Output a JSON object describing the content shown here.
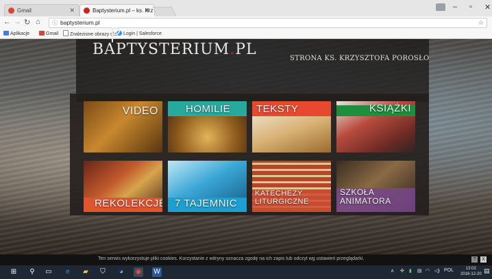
{
  "browser": {
    "tabs": [
      {
        "title": "Gmail",
        "active": false,
        "favicon_color": "#d44638"
      },
      {
        "title": "Baptysterium.pl – ks. Krz",
        "active": true,
        "favicon_color": "#d0221d"
      }
    ],
    "url": "baptysterium.pl",
    "bookmarks": [
      {
        "label": "Aplikacje",
        "icon": "apps-icon"
      },
      {
        "label": "Gmail",
        "icon": "gmail-icon"
      },
      {
        "label": "Znalezione obrazy dla",
        "icon": "page-icon"
      },
      {
        "label": "Login | Salesforce",
        "icon": "salesforce-icon"
      }
    ]
  },
  "site": {
    "logo": {
      "text": "BAPTYSTERIUM",
      "dot": ".",
      "suffix": "PL"
    },
    "tagline": "STRONA KS. KRZYSZTOFA POROSŁO",
    "tiles": [
      {
        "label": "VIDEO"
      },
      {
        "label": "HOMILIE"
      },
      {
        "label": "TEKSTY"
      },
      {
        "label": "KSIĄŻKI"
      },
      {
        "label": "REKOLEKCJE"
      },
      {
        "label": "7 TAJEMNIC"
      },
      {
        "label_line1": "KATECHEZY",
        "label_line2": "LITURGICZNE"
      },
      {
        "label_line1": "SZKOŁA",
        "label_line2": "ANIMATORA"
      }
    ],
    "cookie": {
      "text": "Ten serwis wykorzystuje pliki cookies. Korzystanie z witryny oznacza zgodę na ich zapis lub odczyt wg ustawień przeglądarki.",
      "help": "?",
      "close": "X"
    }
  },
  "taskbar": {
    "language": "POL",
    "time": "13:02",
    "date": "2016-12-20"
  }
}
